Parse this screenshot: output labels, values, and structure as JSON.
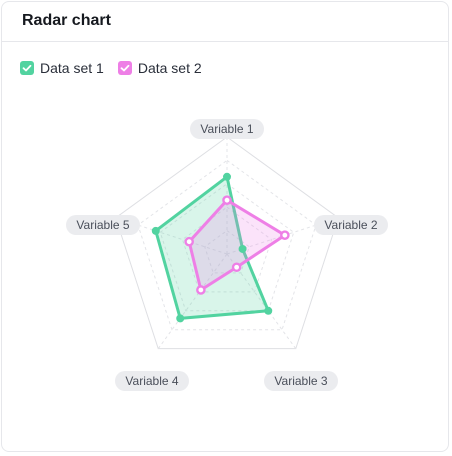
{
  "header": {
    "title": "Radar chart"
  },
  "legend": [
    {
      "label": "Data set 1",
      "color": "#52d3a0"
    },
    {
      "label": "Data set 2",
      "color": "#ee7fe6"
    }
  ],
  "chart_data": {
    "type": "radar",
    "axes": [
      "Variable 1",
      "Variable 2",
      "Variable 3",
      "Variable 4",
      "Variable 5"
    ],
    "max": 5,
    "grid_levels": 5,
    "series": [
      {
        "name": "Data set 1",
        "color": "#52d3a0",
        "values": [
          3.3,
          0.7,
          3.0,
          3.4,
          3.2
        ]
      },
      {
        "name": "Data set 2",
        "color": "#ee7fe6",
        "values": [
          2.3,
          2.6,
          0.7,
          1.9,
          1.7
        ]
      }
    ]
  }
}
